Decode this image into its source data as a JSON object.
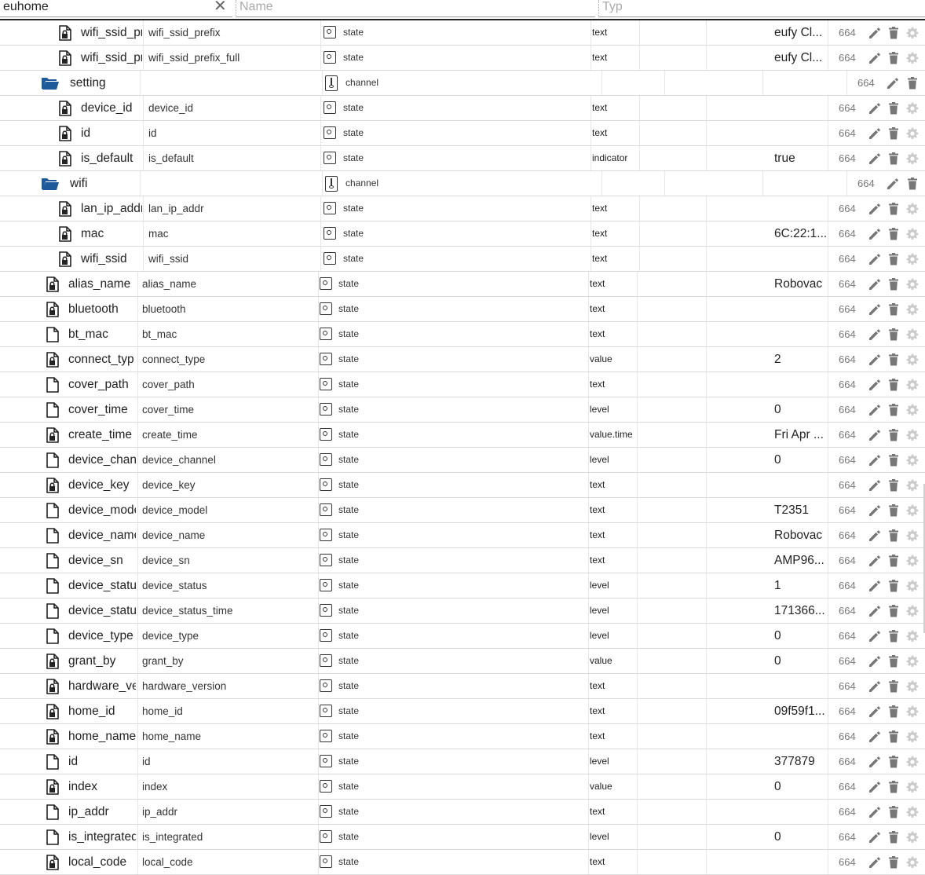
{
  "filter": {
    "id_value": "euhome",
    "name_placeholder": "Name",
    "type_placeholder": "Typ",
    "clear_glyph": "✕"
  },
  "icons": {
    "folder": "folder-open-icon",
    "file": "file-icon",
    "file_locked": "file-lock-icon",
    "state": "state-role-icon",
    "channel": "channel-role-icon",
    "edit": "pencil-icon",
    "delete": "trash-icon",
    "settings": "gear-icon"
  },
  "colors": {
    "folder": "#1e5a9a",
    "action": "#777777",
    "gear": "#c8c8c8",
    "border": "#dcdcdc"
  },
  "rows": [
    {
      "level": 2,
      "kind": "lock",
      "id": "wifi_ssid_pr",
      "name": "wifi_ssid_prefix",
      "role": "state",
      "type": "text",
      "value": "eufy Cl...",
      "acl": "664"
    },
    {
      "level": 2,
      "kind": "lock",
      "id": "wifi_ssid_pr",
      "name": "wifi_ssid_prefix_full",
      "role": "state",
      "type": "text",
      "value": "eufy Cl...",
      "acl": "664"
    },
    {
      "level": 1,
      "kind": "folder",
      "id": "setting",
      "name": "",
      "role": "channel",
      "type": "",
      "value": "",
      "acl": "664"
    },
    {
      "level": 2,
      "kind": "lock",
      "id": "device_id",
      "name": "device_id",
      "role": "state",
      "type": "text",
      "value": "",
      "acl": "664"
    },
    {
      "level": 2,
      "kind": "lock",
      "id": "id",
      "name": "id",
      "role": "state",
      "type": "text",
      "value": "",
      "acl": "664"
    },
    {
      "level": 2,
      "kind": "lock",
      "id": "is_default",
      "name": "is_default",
      "role": "state",
      "type": "indicator",
      "value": "true",
      "acl": "664"
    },
    {
      "level": 1,
      "kind": "folder",
      "id": "wifi",
      "name": "",
      "role": "channel",
      "type": "",
      "value": "",
      "acl": "664"
    },
    {
      "level": 2,
      "kind": "lock",
      "id": "lan_ip_addr",
      "name": "lan_ip_addr",
      "role": "state",
      "type": "text",
      "value": "",
      "acl": "664"
    },
    {
      "level": 2,
      "kind": "lock",
      "id": "mac",
      "name": "mac",
      "role": "state",
      "type": "text",
      "value": "6C:22:1...",
      "acl": "664"
    },
    {
      "level": 2,
      "kind": "lock",
      "id": "wifi_ssid",
      "name": "wifi_ssid",
      "role": "state",
      "type": "text",
      "value": "",
      "acl": "664"
    },
    {
      "level": 0,
      "kind": "lock",
      "id": "alias_name",
      "name": "alias_name",
      "role": "state",
      "type": "text",
      "value": "Robovac",
      "acl": "664"
    },
    {
      "level": 0,
      "kind": "lock",
      "id": "bluetooth",
      "name": "bluetooth",
      "role": "state",
      "type": "text",
      "value": "",
      "acl": "664"
    },
    {
      "level": 0,
      "kind": "file",
      "id": "bt_mac",
      "name": "bt_mac",
      "role": "state",
      "type": "text",
      "value": "",
      "acl": "664"
    },
    {
      "level": 0,
      "kind": "lock",
      "id": "connect_typ",
      "name": "connect_type",
      "role": "state",
      "type": "value",
      "value": "2",
      "acl": "664"
    },
    {
      "level": 0,
      "kind": "file",
      "id": "cover_path",
      "name": "cover_path",
      "role": "state",
      "type": "text",
      "value": "",
      "acl": "664"
    },
    {
      "level": 0,
      "kind": "file",
      "id": "cover_time",
      "name": "cover_time",
      "role": "state",
      "type": "level",
      "value": "0",
      "acl": "664"
    },
    {
      "level": 0,
      "kind": "lock",
      "id": "create_time",
      "name": "create_time",
      "role": "state",
      "type": "value.time",
      "value": "Fri Apr ...",
      "acl": "664"
    },
    {
      "level": 0,
      "kind": "file",
      "id": "device_chan",
      "name": "device_channel",
      "role": "state",
      "type": "level",
      "value": "0",
      "acl": "664"
    },
    {
      "level": 0,
      "kind": "lock",
      "id": "device_key",
      "name": "device_key",
      "role": "state",
      "type": "text",
      "value": "",
      "acl": "664"
    },
    {
      "level": 0,
      "kind": "file",
      "id": "device_mode",
      "name": "device_model",
      "role": "state",
      "type": "text",
      "value": "T2351",
      "acl": "664"
    },
    {
      "level": 0,
      "kind": "file",
      "id": "device_name",
      "name": "device_name",
      "role": "state",
      "type": "text",
      "value": "Robovac",
      "acl": "664"
    },
    {
      "level": 0,
      "kind": "file",
      "id": "device_sn",
      "name": "device_sn",
      "role": "state",
      "type": "text",
      "value": "AMP96...",
      "acl": "664"
    },
    {
      "level": 0,
      "kind": "file",
      "id": "device_statu",
      "name": "device_status",
      "role": "state",
      "type": "level",
      "value": "1",
      "acl": "664"
    },
    {
      "level": 0,
      "kind": "file",
      "id": "device_statu",
      "name": "device_status_time",
      "role": "state",
      "type": "level",
      "value": "171366...",
      "acl": "664"
    },
    {
      "level": 0,
      "kind": "file",
      "id": "device_type",
      "name": "device_type",
      "role": "state",
      "type": "level",
      "value": "0",
      "acl": "664"
    },
    {
      "level": 0,
      "kind": "lock",
      "id": "grant_by",
      "name": "grant_by",
      "role": "state",
      "type": "value",
      "value": "0",
      "acl": "664"
    },
    {
      "level": 0,
      "kind": "lock",
      "id": "hardware_ve",
      "name": "hardware_version",
      "role": "state",
      "type": "text",
      "value": "",
      "acl": "664"
    },
    {
      "level": 0,
      "kind": "lock",
      "id": "home_id",
      "name": "home_id",
      "role": "state",
      "type": "text",
      "value": "09f59f1...",
      "acl": "664"
    },
    {
      "level": 0,
      "kind": "lock",
      "id": "home_name",
      "name": "home_name",
      "role": "state",
      "type": "text",
      "value": "",
      "acl": "664"
    },
    {
      "level": 0,
      "kind": "file",
      "id": "id",
      "name": "id",
      "role": "state",
      "type": "level",
      "value": "377879",
      "acl": "664"
    },
    {
      "level": 0,
      "kind": "lock",
      "id": "index",
      "name": "index",
      "role": "state",
      "type": "value",
      "value": "0",
      "acl": "664"
    },
    {
      "level": 0,
      "kind": "file",
      "id": "ip_addr",
      "name": "ip_addr",
      "role": "state",
      "type": "text",
      "value": "",
      "acl": "664"
    },
    {
      "level": 0,
      "kind": "file",
      "id": "is_integrated",
      "name": "is_integrated",
      "role": "state",
      "type": "level",
      "value": "0",
      "acl": "664"
    },
    {
      "level": 0,
      "kind": "lock",
      "id": "local_code",
      "name": "local_code",
      "role": "state",
      "type": "text",
      "value": "",
      "acl": "664"
    }
  ]
}
